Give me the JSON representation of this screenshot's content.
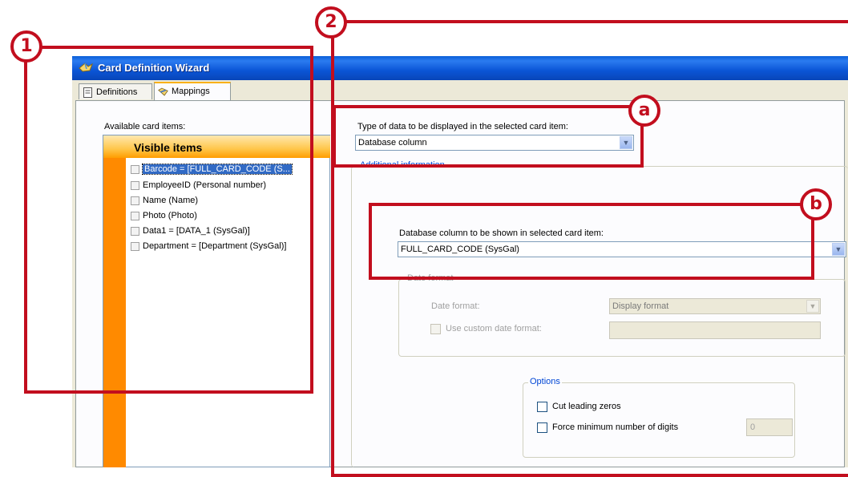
{
  "window": {
    "title": "Card Definition Wizard"
  },
  "tabs": [
    {
      "label": "Definitions",
      "icon": "document-icon"
    },
    {
      "label": "Mappings",
      "icon": "folder-arrow-icon"
    }
  ],
  "left_panel": {
    "available_label": "Available card items:",
    "header": "Visible items",
    "items": [
      {
        "label": "Barcode = [FULL_CARD_CODE (S...",
        "selected": true
      },
      {
        "label": "EmployeeID  (Personal number)"
      },
      {
        "label": "Name (Name)"
      },
      {
        "label": "Photo (Photo)"
      },
      {
        "label": "Data1 = [DATA_1 (SysGal)]"
      },
      {
        "label": "Department = [Department (SysGal)]"
      }
    ]
  },
  "right_panel": {
    "type_label": "Type of data to be displayed in the selected card item:",
    "type_value": "Database column",
    "additional_legend": "Additional information",
    "column_label": "Database column to be shown in selected card item:",
    "column_value": "FULL_CARD_CODE (SysGal)",
    "date_group_legend": "Date format",
    "date_format_label": "Date format:",
    "date_format_value": "Display format",
    "custom_date_label": "Use custom date format:",
    "options_legend": "Options",
    "cut_zeros_label": "Cut leading zeros",
    "force_digits_label": "Force minimum number of digits",
    "digits_value": "0"
  },
  "callouts": {
    "one": "1",
    "two": "2",
    "a": "a",
    "b": "b"
  },
  "colors": {
    "callout": "#c20e1e",
    "list_accent": "#ff8a00",
    "titlebar": "#0b55d6"
  }
}
